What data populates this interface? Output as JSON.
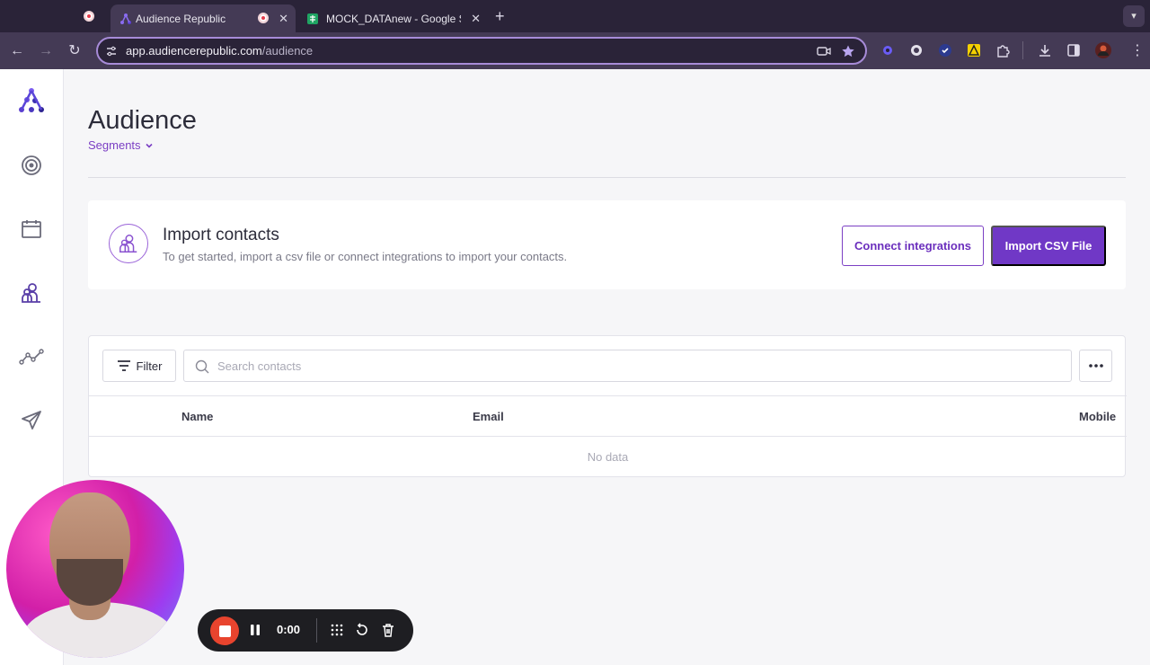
{
  "browser": {
    "tabs": [
      {
        "title": "Audience Republic",
        "active": true
      },
      {
        "title": "MOCK_DATAnew - Google Sh",
        "active": false
      }
    ],
    "new_tab": "+",
    "url_host": "app.audiencerepublic.com",
    "url_path": "/audience",
    "extensions": [
      "extension-icon",
      "tab-search-icon",
      "check-icon",
      "warning-icon",
      "puzzle-icon",
      "download-icon",
      "sidepanel-icon",
      "profile-avatar-icon"
    ]
  },
  "sidebar": {
    "items": [
      "logo",
      "target",
      "calendar",
      "audience",
      "analytics",
      "send"
    ]
  },
  "page": {
    "title": "Audience",
    "segments_label": "Segments"
  },
  "import": {
    "title": "Import contacts",
    "subtitle": "To get started, import a csv file or connect integrations to import your contacts.",
    "connect_label": "Connect integrations",
    "csv_label": "Import CSV File"
  },
  "contacts": {
    "filter_label": "Filter",
    "search_placeholder": "Search contacts",
    "columns": [
      "Name",
      "Email",
      "Mobile"
    ],
    "empty_text": "No data"
  },
  "recorder": {
    "timer": "0:00"
  },
  "colors": {
    "accent": "#7038c6",
    "browser_bg": "#2a2338",
    "record": "#e8442e"
  }
}
